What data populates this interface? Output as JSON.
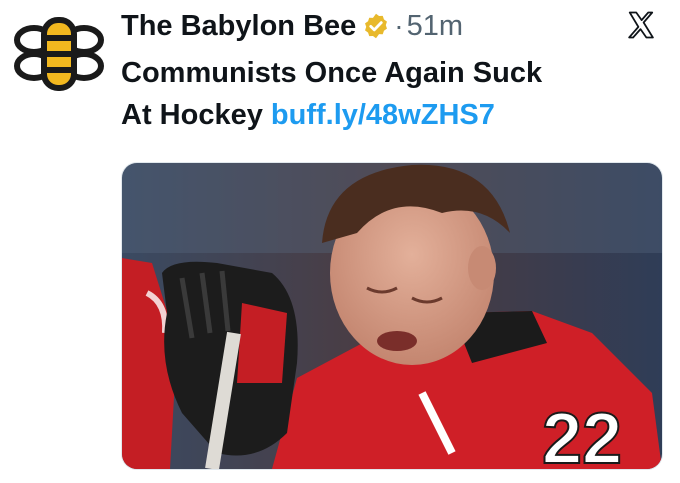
{
  "tweet": {
    "author_name": "The Babylon Bee",
    "time_separator": "·",
    "timestamp": "51m",
    "text_line1": "Communists Once Again Suck",
    "text_line2": "At Hockey",
    "link_text": "buff.ly/48wZHS7",
    "badge_color": "#e8b92c",
    "link_color": "#1d9bf0",
    "jersey_number": "22"
  },
  "icons": {
    "avatar": "bee-logo-icon",
    "badge": "verified-gold-badge-icon",
    "platform": "x-logo-icon"
  }
}
